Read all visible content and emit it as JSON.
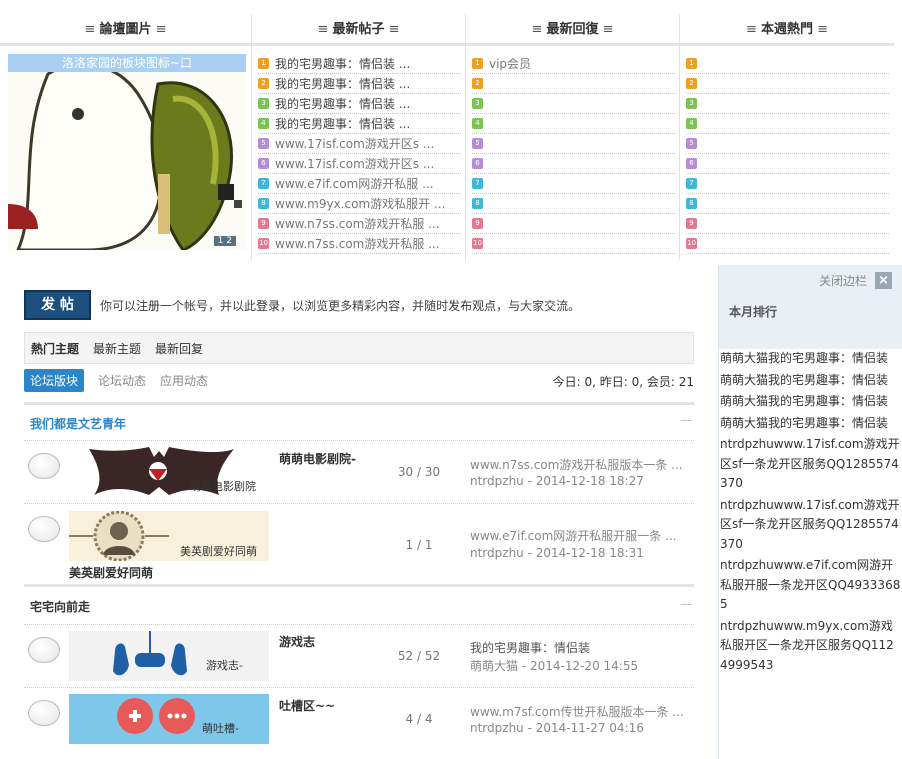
{
  "top": {
    "columns": [
      {
        "title": "論壇圖片"
      },
      {
        "title": "最新帖子"
      },
      {
        "title": "最新回復"
      },
      {
        "title": "本週熱門"
      }
    ],
    "pic_caption": "洛洛家园的板块图标~口",
    "pic_pager": "1 2",
    "latest_posts": [
      {
        "n": "1",
        "t": "我的宅男趣事：情侣装 ..."
      },
      {
        "n": "2",
        "t": "我的宅男趣事：情侣装 ..."
      },
      {
        "n": "3",
        "t": "我的宅男趣事：情侣装 ..."
      },
      {
        "n": "4",
        "t": "我的宅男趣事：情侣装 ..."
      },
      {
        "n": "5",
        "t": "www.17isf.com游戏开区s ..."
      },
      {
        "n": "6",
        "t": "www.17isf.com游戏开区s ..."
      },
      {
        "n": "7",
        "t": "www.e7if.com网游开私服 ..."
      },
      {
        "n": "8",
        "t": "www.m9yx.com游戏私服开 ..."
      },
      {
        "n": "9",
        "t": "www.n7ss.com游戏开私服 ..."
      },
      {
        "n": "10",
        "t": "www.n7ss.com游戏开私服 ..."
      }
    ],
    "latest_replies": [
      {
        "n": "1",
        "t": "vip会员"
      },
      {
        "n": "2",
        "t": ""
      },
      {
        "n": "3",
        "t": ""
      },
      {
        "n": "4",
        "t": ""
      },
      {
        "n": "5",
        "t": ""
      },
      {
        "n": "6",
        "t": ""
      },
      {
        "n": "7",
        "t": ""
      },
      {
        "n": "8",
        "t": ""
      },
      {
        "n": "9",
        "t": ""
      },
      {
        "n": "10",
        "t": ""
      }
    ],
    "weekly_hot": [
      {
        "n": "1"
      },
      {
        "n": "2"
      },
      {
        "n": "3"
      },
      {
        "n": "4"
      },
      {
        "n": "5"
      },
      {
        "n": "6"
      },
      {
        "n": "7"
      },
      {
        "n": "8"
      },
      {
        "n": "9"
      },
      {
        "n": "10"
      }
    ],
    "badge_colors": [
      "#f0a020",
      "#f0a020",
      "#7cc255",
      "#7cc255",
      "#b58cd6",
      "#b58cd6",
      "#3fb8d8",
      "#3fb8d8",
      "#e57890",
      "#e57890"
    ]
  },
  "post_button": "发 帖",
  "notice": {
    "pre": "你可以",
    "register": "注册",
    "mid1": "一个帐号，并以此",
    "login": "登录",
    "mid2": "，以浏览更多精彩内容，并随时",
    "publish": "发布观点",
    "post": "，与大家交流。"
  },
  "main_tabs": [
    "熱门主题",
    "最新主题",
    "最新回复"
  ],
  "sub_tabs": [
    "论坛版块",
    "论坛动态",
    "应用动态"
  ],
  "stats": "今日: 0, 昨日: 0, 会员: 21",
  "sections": [
    {
      "title": "我们都是文艺青年",
      "forums": [
        {
          "name": "萌萌电影剧院-",
          "img_label": "萌萌电影剧院",
          "count": "30 / 30",
          "last_title": "www.n7ss.com游戏开私服版本一条 ...",
          "last_meta": "ntrdpzhu - 2014-12-18 18:27"
        },
        {
          "name": "",
          "img_label": "美英剧爱好同萌",
          "below_label": "美英剧爱好同萌",
          "count": "1 / 1",
          "last_title": "www.e7if.com网游开私服开服一条 ...",
          "last_meta": "ntrdpzhu - 2014-12-18 18:31"
        }
      ]
    },
    {
      "title": "宅宅向前走",
      "forums": [
        {
          "name": "游戏志",
          "img_label": "游戏志-",
          "count": "52 / 52",
          "last_title": "我的宅男趣事：情侣装",
          "last_meta": "萌萌大猫 - 2014-12-20 14:55"
        },
        {
          "name": "吐槽区~~",
          "img_label": "萌吐槽-",
          "count": "4 / 4",
          "last_title": "www.m7sf.com传世开私服版本一条 ...",
          "last_meta": "ntrdpzhu - 2014-11-27 04:16"
        }
      ]
    }
  ],
  "section_minimize": "—",
  "sidebar": {
    "close_label": "关闭边栏",
    "close_icon": "×",
    "title": "本月排行",
    "entries": [
      "萌萌大猫我的宅男趣事：情侣装",
      "萌萌大猫我的宅男趣事：情侣装",
      "萌萌大猫我的宅男趣事：情侣装",
      "萌萌大猫我的宅男趣事：情侣装",
      "ntrdpzhuwww.17isf.com游戏开区sf一条龙开区服务QQ1285574370",
      "ntrdpzhuwww.17isf.com游戏开区sf一条龙开区服务QQ1285574370",
      "ntrdpzhuwww.e7if.com网游开私服开服一条龙开区QQ49333685",
      "ntrdpzhuwww.m9yx.com游戏私服开区一条龙开区服务QQ1124999543"
    ]
  },
  "colors": {
    "accent": "#2a86c9",
    "post_button": "#1d4f7e",
    "sidebar_bg": "#e9eff4"
  }
}
